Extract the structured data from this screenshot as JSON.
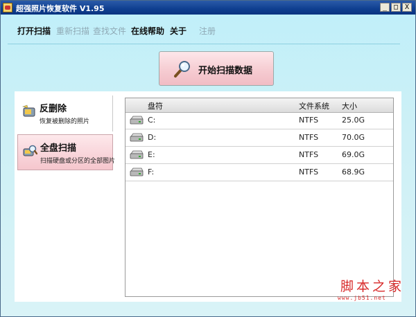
{
  "window": {
    "title": "超强照片恢复软件 V1.95",
    "controls": {
      "minimize": "_",
      "maximize": "□",
      "close": "X"
    }
  },
  "menu": {
    "items": [
      {
        "label": "打开扫描",
        "enabled": true
      },
      {
        "label": "重新扫描",
        "enabled": false
      },
      {
        "label": "查找文件",
        "enabled": false
      },
      {
        "label": "在线帮助",
        "enabled": true
      },
      {
        "label": "关于",
        "enabled": true
      },
      {
        "label": "注册",
        "enabled": false
      }
    ]
  },
  "scan_button": {
    "label": "开始扫描数据",
    "icon": "magnifier-icon"
  },
  "modes": [
    {
      "title": "反删除",
      "subtitle": "恢复被删除的照片",
      "icon": "undelete-icon"
    },
    {
      "title": "全盘扫描",
      "subtitle": "扫描硬盘或分区的全部图片",
      "icon": "full-scan-icon"
    }
  ],
  "drive_table": {
    "columns": [
      "盘符",
      "文件系统",
      "大小"
    ],
    "rows": [
      {
        "drive": "C:",
        "fs": "NTFS",
        "size": "25.0G"
      },
      {
        "drive": "D:",
        "fs": "NTFS",
        "size": "70.0G"
      },
      {
        "drive": "E:",
        "fs": "NTFS",
        "size": "69.0G"
      },
      {
        "drive": "F:",
        "fs": "NTFS",
        "size": "68.9G"
      }
    ]
  },
  "watermark": {
    "main": "脚本之家",
    "sub": "www.jb51.net"
  },
  "colors": {
    "title_bar": "#0f3f90",
    "background": "#cdf0f6",
    "button_pink": "#f6ccd2",
    "watermark": "#d82a2a"
  }
}
